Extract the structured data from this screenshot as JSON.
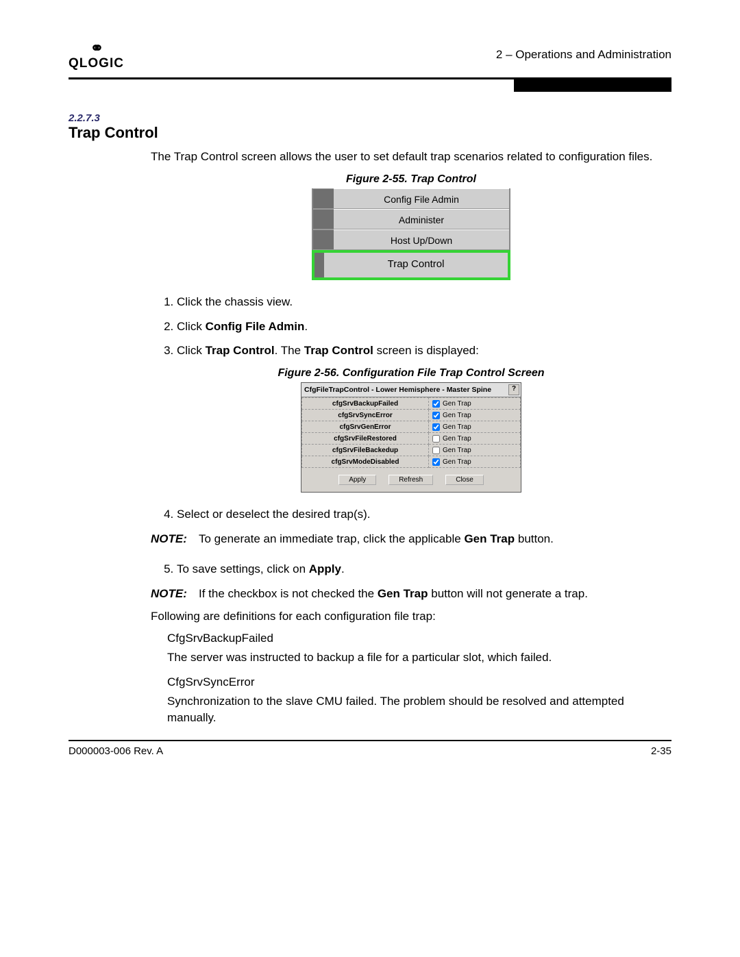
{
  "header": {
    "logo_top": "⚭",
    "logo_name": "QLOGIC",
    "chapter": "2 – Operations and Administration"
  },
  "section": {
    "number": "2.2.7.3",
    "title": "Trap Control",
    "intro": "The Trap Control screen allows the user to set default trap scenarios related to configuration files."
  },
  "figure55": {
    "caption": "Figure 2-55. Trap Control",
    "tab1": "Config File Admin",
    "tab2": "Administer",
    "tab3": "Host Up/Down",
    "tab_active": "Trap Control"
  },
  "steps1": {
    "s1": "Click the chassis view.",
    "s2_pre": "Click ",
    "s2_b": "Config File Admin",
    "s2_post": ".",
    "s3_pre": "Click ",
    "s3_b1": "Trap Control",
    "s3_mid": ". The ",
    "s3_b2": "Trap Control",
    "s3_post": " screen is displayed:"
  },
  "figure56": {
    "caption": "Figure 2-56. Configuration File Trap Control Screen",
    "dialog_title": "CfgFileTrapControl - Lower Hemisphere - Master Spine",
    "help": "?",
    "rows": [
      {
        "name": "cfgSrvBackupFailed",
        "checked": true
      },
      {
        "name": "cfgSrvSyncError",
        "checked": true
      },
      {
        "name": "cfgSrvGenError",
        "checked": true
      },
      {
        "name": "cfgSrvFileRestored",
        "checked": false
      },
      {
        "name": "cfgSrvFileBackedup",
        "checked": false
      },
      {
        "name": "cfgSrvModeDisabled",
        "checked": true
      }
    ],
    "btn_label": "Gen Trap",
    "apply": "Apply",
    "refresh": "Refresh",
    "close": "Close"
  },
  "steps2": {
    "s4": "Select or deselect the desired trap(s).",
    "note1_pre": "To generate an immediate trap, click the applicable ",
    "note1_b": "Gen Trap",
    "note1_post": " button.",
    "s5_pre": "To save settings, click on ",
    "s5_b": "Apply",
    "s5_post": ".",
    "note2_pre": "If the checkbox is not checked the ",
    "note2_b": "Gen Trap",
    "note2_post": " button will not generate a trap."
  },
  "labels": {
    "note": "NOTE:"
  },
  "definitions": {
    "lead": "Following are definitions for each configuration file trap:",
    "d1_name": "CfgSrvBackupFailed",
    "d1_text": "The server was instructed to backup a file for a particular slot, which failed.",
    "d2_name": "CfgSrvSyncError",
    "d2_text": "Synchronization to the slave CMU failed. The problem should be resolved and attempted manually."
  },
  "footer": {
    "left": "D000003-006 Rev. A",
    "right": "2-35"
  }
}
